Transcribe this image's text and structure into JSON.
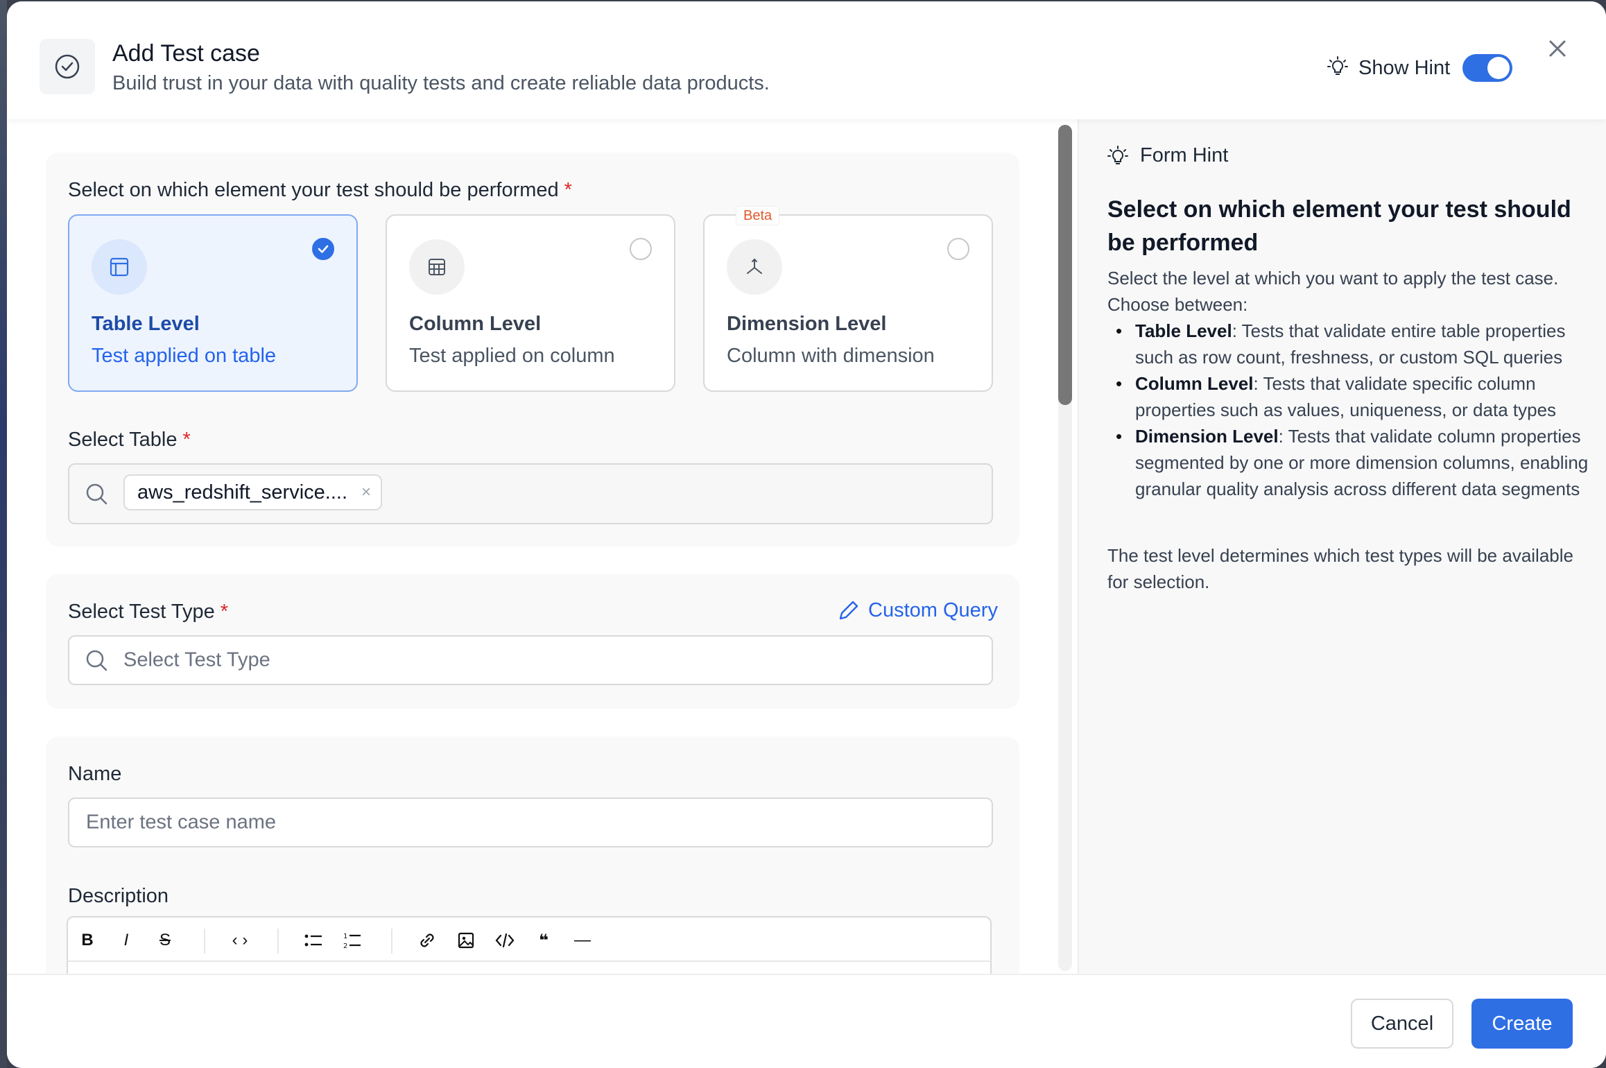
{
  "header": {
    "title": "Add Test case",
    "subtitle": "Build trust in your data with quality tests and create reliable data products.",
    "hint_toggle_label": "Show Hint",
    "hint_toggle_on": true
  },
  "test_level": {
    "label": "Select on which element your test should be performed",
    "required_mark": "*",
    "options": [
      {
        "title": "Table Level",
        "desc": "Test applied on table",
        "selected": true,
        "icon": "table-layout-icon"
      },
      {
        "title": "Column Level",
        "desc": "Test applied on column",
        "selected": false,
        "icon": "grid-icon"
      },
      {
        "title": "Dimension Level",
        "desc": "Column with dimension",
        "selected": false,
        "icon": "dimension-icon",
        "badge": "Beta"
      }
    ]
  },
  "select_table": {
    "label": "Select Table",
    "required_mark": "*",
    "selected_chip": "aws_redshift_service....",
    "chip_remove": "×"
  },
  "test_type": {
    "label": "Select Test Type",
    "required_mark": "*",
    "placeholder": "Select Test Type",
    "custom_query_label": "Custom Query"
  },
  "name": {
    "label": "Name",
    "placeholder": "Enter test case name"
  },
  "description": {
    "label": "Description",
    "toolbar": {
      "bold": "B",
      "italic": "I",
      "strike": "S",
      "code": "‹ ›",
      "quote": "❝",
      "hr": "—"
    }
  },
  "hint": {
    "heading": "Form Hint",
    "title": "Select on which element your test should be performed",
    "intro": "Select the level at which you want to apply the test case. Choose between:",
    "items": [
      {
        "term": "Table Level",
        "text": ": Tests that validate entire table properties such as row count, freshness, or custom SQL queries"
      },
      {
        "term": "Column Level",
        "text": ": Tests that validate specific column properties such as values, uniqueness, or data types"
      },
      {
        "term": "Dimension Level",
        "text": ": Tests that validate column properties segmented by one or more dimension columns, enabling granular quality analysis across different data segments"
      }
    ],
    "outro": "The test level determines which test types will be available for selection."
  },
  "footer": {
    "cancel_label": "Cancel",
    "create_label": "Create"
  },
  "colors": {
    "primary": "#2f6fe4",
    "required": "#dc2626",
    "beta": "#e05a2b"
  }
}
